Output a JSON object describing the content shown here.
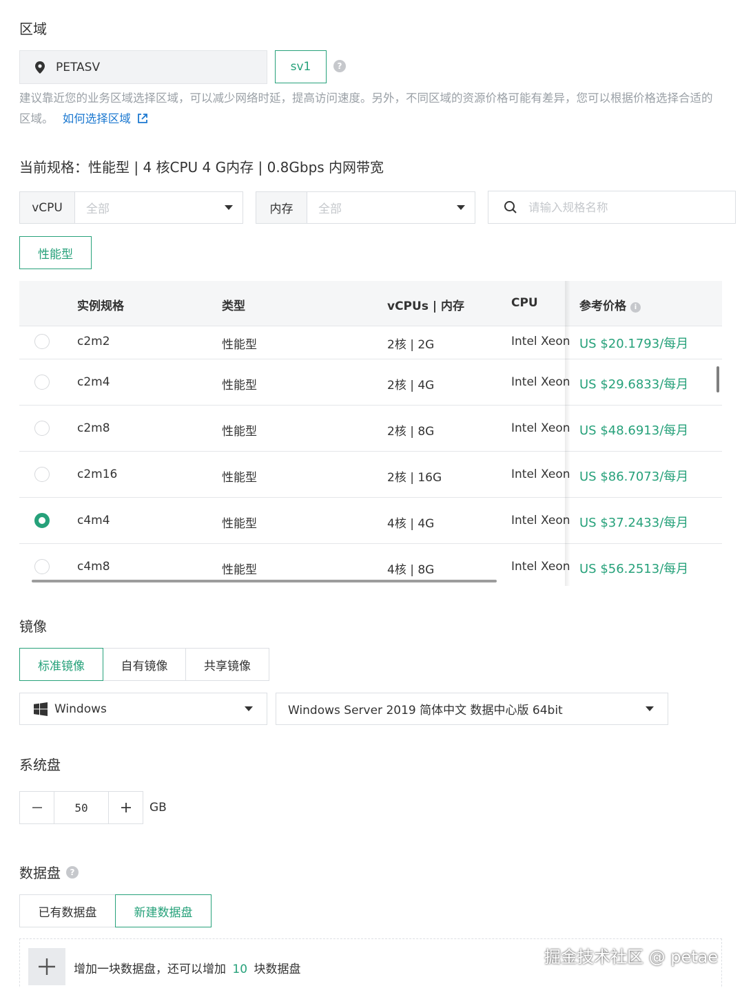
{
  "region": {
    "title": "区域",
    "location": "PETASV",
    "zone": "sv1",
    "hint_text": "建议靠近您的业务区域选择区域，可以减少网络时延，提高访问速度。另外，不同区域的资源价格可能有差异，您可以根据价格选择合适的区域。",
    "hint_link": "如何选择区域"
  },
  "spec": {
    "current": "当前规格：性能型 | 4 核CPU 4 G内存 | 0.8Gbps 内网带宽",
    "filters": {
      "vcpu_label": "vCPU",
      "vcpu_value": "全部",
      "mem_label": "内存",
      "mem_value": "全部",
      "search_placeholder": "请输入规格名称"
    },
    "type_tag": "性能型",
    "columns": [
      "实例规格",
      "类型",
      "vCPUs | 内存",
      "CPU",
      "参考价格"
    ],
    "rows": [
      {
        "name": "c2m2",
        "type": "性能型",
        "vcpu_mem": "2核 | 2G",
        "cpu": "Intel Xeon",
        "price": "US $20.1793/每月",
        "selected": false
      },
      {
        "name": "c2m4",
        "type": "性能型",
        "vcpu_mem": "2核 | 4G",
        "cpu": "Intel Xeon",
        "price": "US $29.6833/每月",
        "selected": false
      },
      {
        "name": "c2m8",
        "type": "性能型",
        "vcpu_mem": "2核 | 8G",
        "cpu": "Intel Xeon",
        "price": "US $48.6913/每月",
        "selected": false
      },
      {
        "name": "c2m16",
        "type": "性能型",
        "vcpu_mem": "2核 | 16G",
        "cpu": "Intel Xeon",
        "price": "US $86.7073/每月",
        "selected": false
      },
      {
        "name": "c4m4",
        "type": "性能型",
        "vcpu_mem": "4核 | 4G",
        "cpu": "Intel Xeon",
        "price": "US $37.2433/每月",
        "selected": true
      },
      {
        "name": "c4m8",
        "type": "性能型",
        "vcpu_mem": "4核 | 8G",
        "cpu": "Intel Xeon",
        "price": "US $56.2513/每月",
        "selected": false
      }
    ]
  },
  "image": {
    "title": "镜像",
    "tabs": [
      "标准镜像",
      "自有镜像",
      "共享镜像"
    ],
    "active_tab": "标准镜像",
    "os": "Windows",
    "version": "Windows Server 2019 简体中文 数据中心版 64bit"
  },
  "system_disk": {
    "title": "系统盘",
    "size": "50",
    "unit": "GB"
  },
  "data_disk": {
    "title": "数据盘",
    "tabs": [
      "已有数据盘",
      "新建数据盘"
    ],
    "active_tab": "新建数据盘",
    "add_prefix": "增加一块数据盘，还可以增加",
    "add_count": "10",
    "add_suffix": "块数据盘"
  },
  "watermark": "掘金技术社区 @ petae",
  "colors": {
    "accent": "#26a17a",
    "link": "#1b78d0"
  }
}
